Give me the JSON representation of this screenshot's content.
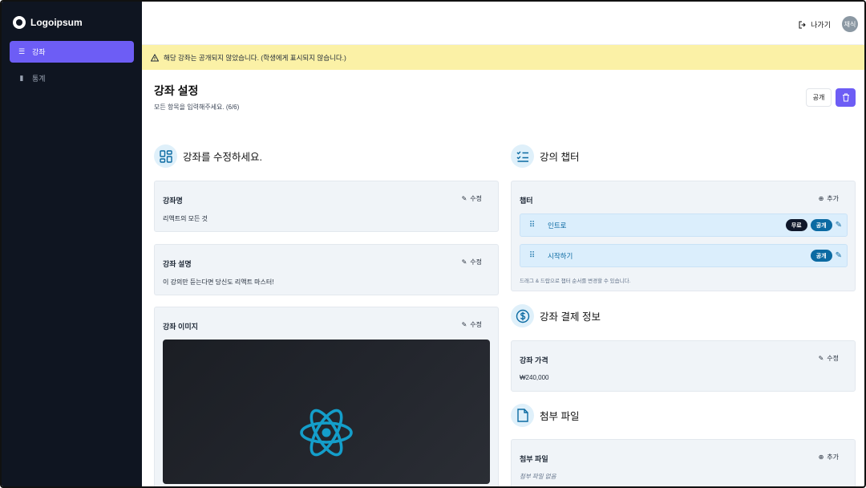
{
  "app": {
    "logo_text": "Logoipsum"
  },
  "sidebar": {
    "items": [
      {
        "label": "강좌",
        "icon": "list-icon",
        "active": true
      },
      {
        "label": "통계",
        "icon": "bar-chart-icon",
        "active": false
      }
    ]
  },
  "header": {
    "exit_label": "나가기",
    "avatar_text": "채식"
  },
  "banner": {
    "text": "해당 강좌는 공개되지 않았습니다. (학생에게 표시되지 않습니다.)"
  },
  "page": {
    "title": "강좌 설정",
    "subtitle": "모든 항목을 입력해주세요. (6/6)",
    "public_button": "공개"
  },
  "left": {
    "section_title": "강좌를 수정하세요.",
    "edit_label": "수정",
    "name": {
      "label": "강좌명",
      "value": "리액트의 모든 것"
    },
    "description": {
      "label": "강좌 설명",
      "value": "이 강의만 듣는다면 당신도 리액트 마스터!"
    },
    "image": {
      "label": "강좌 이미지"
    }
  },
  "right": {
    "chapters_section_title": "강의 챕터",
    "chapters_card": {
      "label": "챕터",
      "add_label": "추가",
      "items": [
        {
          "title": "인트로",
          "free_badge": "무료",
          "status_badge": "공개"
        },
        {
          "title": "시작하기",
          "status_badge": "공개"
        }
      ],
      "hint": "드래그 & 드랍으로 챕터 순서를 변경할 수 있습니다."
    },
    "payment_section_title": "강좌 결제 정보",
    "price": {
      "label": "강좌 가격",
      "value": "₩240,000",
      "edit_label": "수정"
    },
    "attachments_section_title": "첨부 파일",
    "attachments_card": {
      "label": "첨부 파일",
      "add_label": "추가",
      "empty_text": "첨부 파일 없음"
    }
  },
  "colors": {
    "accent": "#6d5df5",
    "sidebar_bg": "#0f1521",
    "banner_bg": "#fbf1a6",
    "primary_blue": "#0b6aa2",
    "react_blue": "#149eca"
  }
}
